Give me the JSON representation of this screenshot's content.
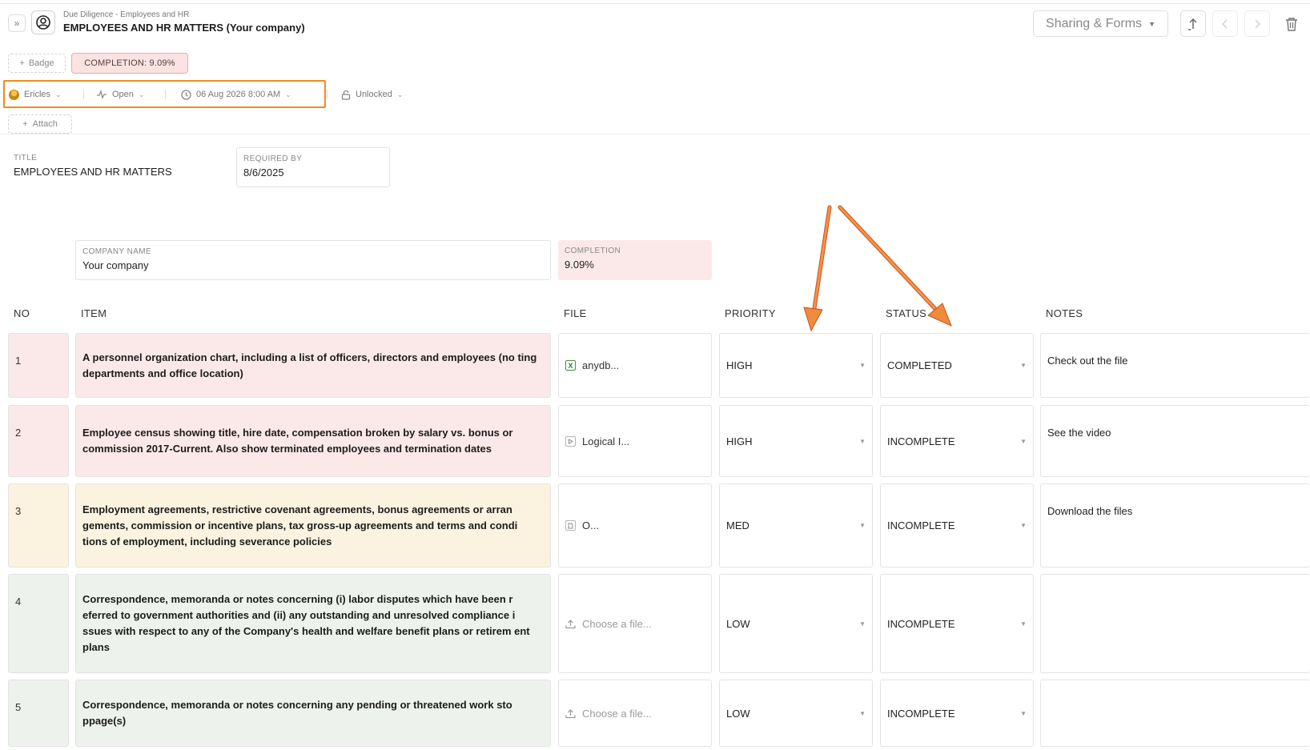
{
  "header": {
    "breadcrumb": "Due Diligence - Employees and HR",
    "title": "EMPLOYEES AND HR MATTERS (Your company)",
    "sharing_label": "Sharing & Forms"
  },
  "badges": {
    "add_label": "Badge",
    "completion": "COMPLETION: 9.09%"
  },
  "meta": {
    "assignee": "Ericles",
    "status": "Open",
    "due": "06 Aug 2026 8:00 AM",
    "lock": "Unlocked",
    "attach_label": "Attach"
  },
  "fields": {
    "title_label": "TITLE",
    "title_value": "EMPLOYEES AND HR MATTERS",
    "required_label": "REQUIRED BY",
    "required_value": "8/6/2025",
    "company_label": "COMPANY NAME",
    "company_value": "Your company",
    "completion_label": "COMPLETION",
    "completion_value": "9.09%"
  },
  "table": {
    "headers": {
      "no": "NO",
      "item": "ITEM",
      "file": "FILE",
      "priority": "PRIORITY",
      "status": "STATUS",
      "notes": "NOTES"
    },
    "rows": [
      {
        "no": "1",
        "item": "A personnel organization chart, including a list of officers, directors and employees (no ting departments and office location)",
        "file": "anydb...",
        "file_icon": "excel-file-icon",
        "priority": "HIGH",
        "status": "COMPLETED",
        "notes": "Check out the file"
      },
      {
        "no": "2",
        "item": "Employee census showing title, hire date, compensation broken by salary vs. bonus or commission 2017-Current.  Also show terminated employees and termination dates",
        "file": "Logical I...",
        "file_icon": "video-file-icon",
        "priority": "HIGH",
        "status": "INCOMPLETE",
        "notes": "See the video"
      },
      {
        "no": "3",
        "item": "Employment agreements, restrictive covenant agreements, bonus agreements or arran gements, commission or incentive plans, tax gross-up agreements and terms and condi tions of employment, including severance policies",
        "file": "O...",
        "file_icon": "document-file-icon",
        "priority": "MED",
        "status": "INCOMPLETE",
        "notes": "Download the files"
      },
      {
        "no": "4",
        "item": "Correspondence, memoranda or notes concerning (i) labor disputes which have been r eferred to government authorities and (ii) any outstanding and unresolved compliance i ssues with respect to any of the Company's health and welfare benefit plans or retirem ent plans",
        "file": "Choose a file...",
        "file_icon": "upload-icon",
        "priority": "LOW",
        "status": "INCOMPLETE",
        "notes": ""
      },
      {
        "no": "5",
        "item": "Correspondence, memoranda or notes concerning any pending or threatened work sto ppage(s)",
        "file": "Choose a file...",
        "file_icon": "upload-icon",
        "priority": "LOW",
        "status": "INCOMPLETE",
        "notes": ""
      }
    ]
  },
  "colors": {
    "accent_orange": "#f08a1c",
    "pink": "#fbe9e9",
    "yellow": "#fbf3df",
    "green": "#eef2ec"
  }
}
